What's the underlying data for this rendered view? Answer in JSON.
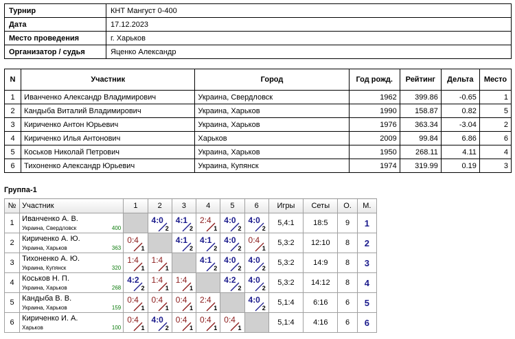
{
  "info": [
    {
      "label": "Турнир",
      "value": "КНТ Мангуст 0-400"
    },
    {
      "label": "Дата",
      "value": "17.12.2023"
    },
    {
      "label": "Место проведения",
      "value": "г. Харьков"
    },
    {
      "label": "Организатор / судья",
      "value": "Яценко Александр"
    }
  ],
  "participants": {
    "headers": [
      "N",
      "Участник",
      "Город",
      "Год рожд.",
      "Рейтинг",
      "Дельта",
      "Место"
    ],
    "rows": [
      [
        "1",
        "Иванченко Александр Владимирович",
        "Украина, Свердловск",
        "1962",
        "399.86",
        "-0.65",
        "1"
      ],
      [
        "2",
        "Кандыба Виталий Владимирович",
        "Украина, Харьков",
        "1990",
        "158.87",
        "0.82",
        "5"
      ],
      [
        "3",
        "Кириченко Антон Юрьевич",
        "Украина, Харьков",
        "1976",
        "363.34",
        "-3.04",
        "2"
      ],
      [
        "4",
        "Кириченко Илья Антонович",
        "Харьков",
        "2009",
        "99.84",
        "6.86",
        "6"
      ],
      [
        "5",
        "Коськов Николай Петрович",
        "Украина, Харьков",
        "1950",
        "268.11",
        "4.11",
        "4"
      ],
      [
        "6",
        "Тихоненко Александр Юрьевич",
        "Украина, Купянск",
        "1974",
        "319.99",
        "0.19",
        "3"
      ]
    ]
  },
  "group": {
    "title": "Группа-1",
    "headers": [
      "№",
      "Участник",
      "1",
      "2",
      "3",
      "4",
      "5",
      "6",
      "Игры",
      "Сеты",
      "О.",
      "М."
    ],
    "rows": [
      {
        "n": "1",
        "name": "Иванченко А. В.",
        "city": "Украина, Свердловск",
        "rating": "400",
        "cells": [
          null,
          {
            "s": "4:0",
            "p": "2",
            "w": true
          },
          {
            "s": "4:1",
            "p": "2",
            "w": true
          },
          {
            "s": "2:4",
            "p": "1",
            "w": false
          },
          {
            "s": "4:0",
            "p": "2",
            "w": true
          },
          {
            "s": "4:0",
            "p": "2",
            "w": true
          }
        ],
        "games": "5,4:1",
        "sets": "18:5",
        "points": "9",
        "place": "1"
      },
      {
        "n": "2",
        "name": "Кириченко А. Ю.",
        "city": "Украина, Харьков",
        "rating": "363",
        "cells": [
          {
            "s": "0:4",
            "p": "1",
            "w": false
          },
          null,
          {
            "s": "4:1",
            "p": "2",
            "w": true
          },
          {
            "s": "4:1",
            "p": "2",
            "w": true
          },
          {
            "s": "4:0",
            "p": "2",
            "w": true
          },
          {
            "s": "0:4",
            "p": "1",
            "w": false
          }
        ],
        "games": "5,3:2",
        "sets": "12:10",
        "points": "8",
        "place": "2"
      },
      {
        "n": "3",
        "name": "Тихоненко А. Ю.",
        "city": "Украина, Купянск",
        "rating": "320",
        "cells": [
          {
            "s": "1:4",
            "p": "1",
            "w": false
          },
          {
            "s": "1:4",
            "p": "1",
            "w": false
          },
          null,
          {
            "s": "4:1",
            "p": "2",
            "w": true
          },
          {
            "s": "4:0",
            "p": "2",
            "w": true
          },
          {
            "s": "4:0",
            "p": "2",
            "w": true
          }
        ],
        "games": "5,3:2",
        "sets": "14:9",
        "points": "8",
        "place": "3"
      },
      {
        "n": "4",
        "name": "Коськов Н. П.",
        "city": "Украина, Харьков",
        "rating": "268",
        "cells": [
          {
            "s": "4:2",
            "p": "2",
            "w": true
          },
          {
            "s": "1:4",
            "p": "1",
            "w": false
          },
          {
            "s": "1:4",
            "p": "1",
            "w": false
          },
          null,
          {
            "s": "4:2",
            "p": "2",
            "w": true
          },
          {
            "s": "4:0",
            "p": "2",
            "w": true
          }
        ],
        "games": "5,3:2",
        "sets": "14:12",
        "points": "8",
        "place": "4"
      },
      {
        "n": "5",
        "name": "Кандыба В. В.",
        "city": "Украина, Харьков",
        "rating": "159",
        "cells": [
          {
            "s": "0:4",
            "p": "1",
            "w": false
          },
          {
            "s": "0:4",
            "p": "1",
            "w": false
          },
          {
            "s": "0:4",
            "p": "1",
            "w": false
          },
          {
            "s": "2:4",
            "p": "1",
            "w": false
          },
          null,
          {
            "s": "4:0",
            "p": "2",
            "w": true
          }
        ],
        "games": "5,1:4",
        "sets": "6:16",
        "points": "6",
        "place": "5"
      },
      {
        "n": "6",
        "name": "Кириченко И. А.",
        "city": "Харьков",
        "rating": "100",
        "cells": [
          {
            "s": "0:4",
            "p": "1",
            "w": false
          },
          {
            "s": "4:0",
            "p": "2",
            "w": true
          },
          {
            "s": "0:4",
            "p": "1",
            "w": false
          },
          {
            "s": "0:4",
            "p": "1",
            "w": false
          },
          {
            "s": "0:4",
            "p": "1",
            "w": false
          },
          null
        ],
        "games": "5,1:4",
        "sets": "4:16",
        "points": "6",
        "place": "6"
      }
    ]
  },
  "colors": {
    "win": "#1a1a8c",
    "loss": "#8b1a1a",
    "rating": "#0a7a0a",
    "self_cell": "#d0d0d0"
  }
}
